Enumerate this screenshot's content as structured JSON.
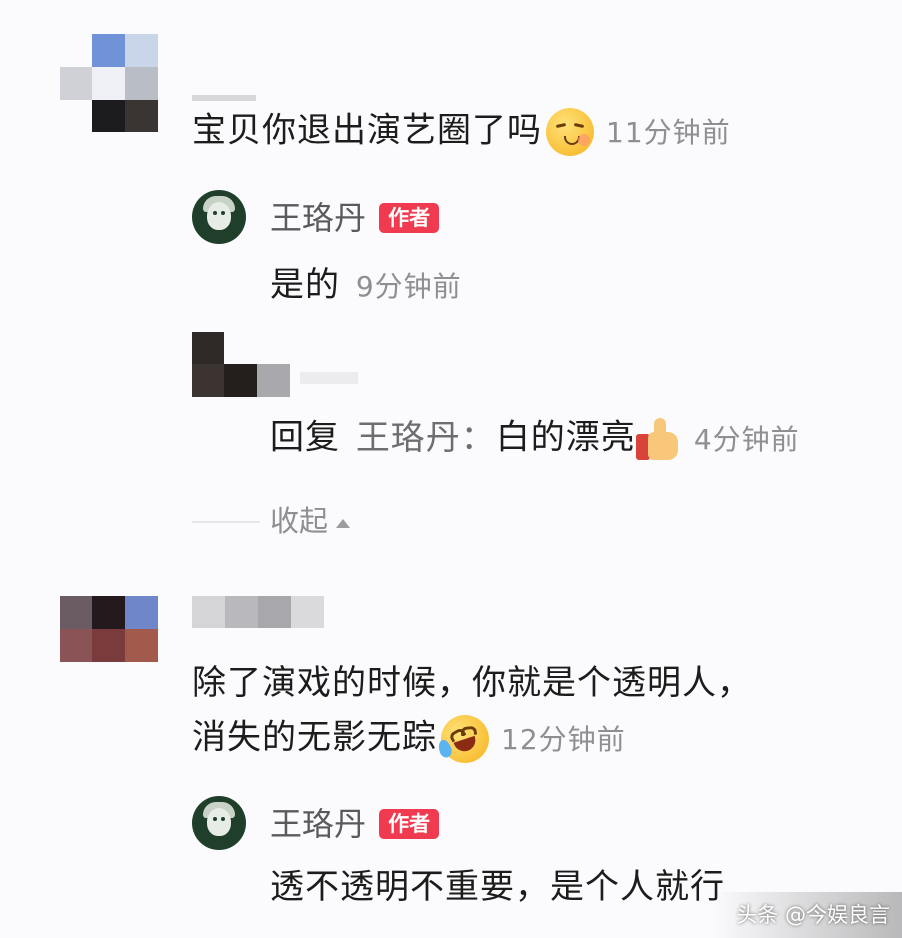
{
  "comment1": {
    "text": "宝贝你退出演艺圈了吗",
    "emoji": "pensive-face-emoji",
    "time": "11分钟前",
    "replies": [
      {
        "author": "王珞丹",
        "badge": "作者",
        "text": "是的",
        "time": "9分钟前"
      },
      {
        "reply_label": "回复",
        "reply_target": "王珞丹：",
        "text": "白的漂亮",
        "emoji": "thumbs-up-emoji",
        "time": "4分钟前"
      }
    ],
    "collapse_label": "收起"
  },
  "comment2": {
    "line1": "除了演戏的时候，你就是个透明人，",
    "line2": "消失的无影无踪",
    "emoji": "rolling-laughing-emoji",
    "time": "12分钟前",
    "reply": {
      "author": "王珞丹",
      "badge": "作者",
      "text": "透不透明不重要，是个人就行"
    }
  },
  "watermark": "头条 @今娱良言",
  "colors": {
    "badge": "#f03a4f",
    "author_avatar": "#1f3f2b",
    "time_text": "#8e8e93"
  }
}
